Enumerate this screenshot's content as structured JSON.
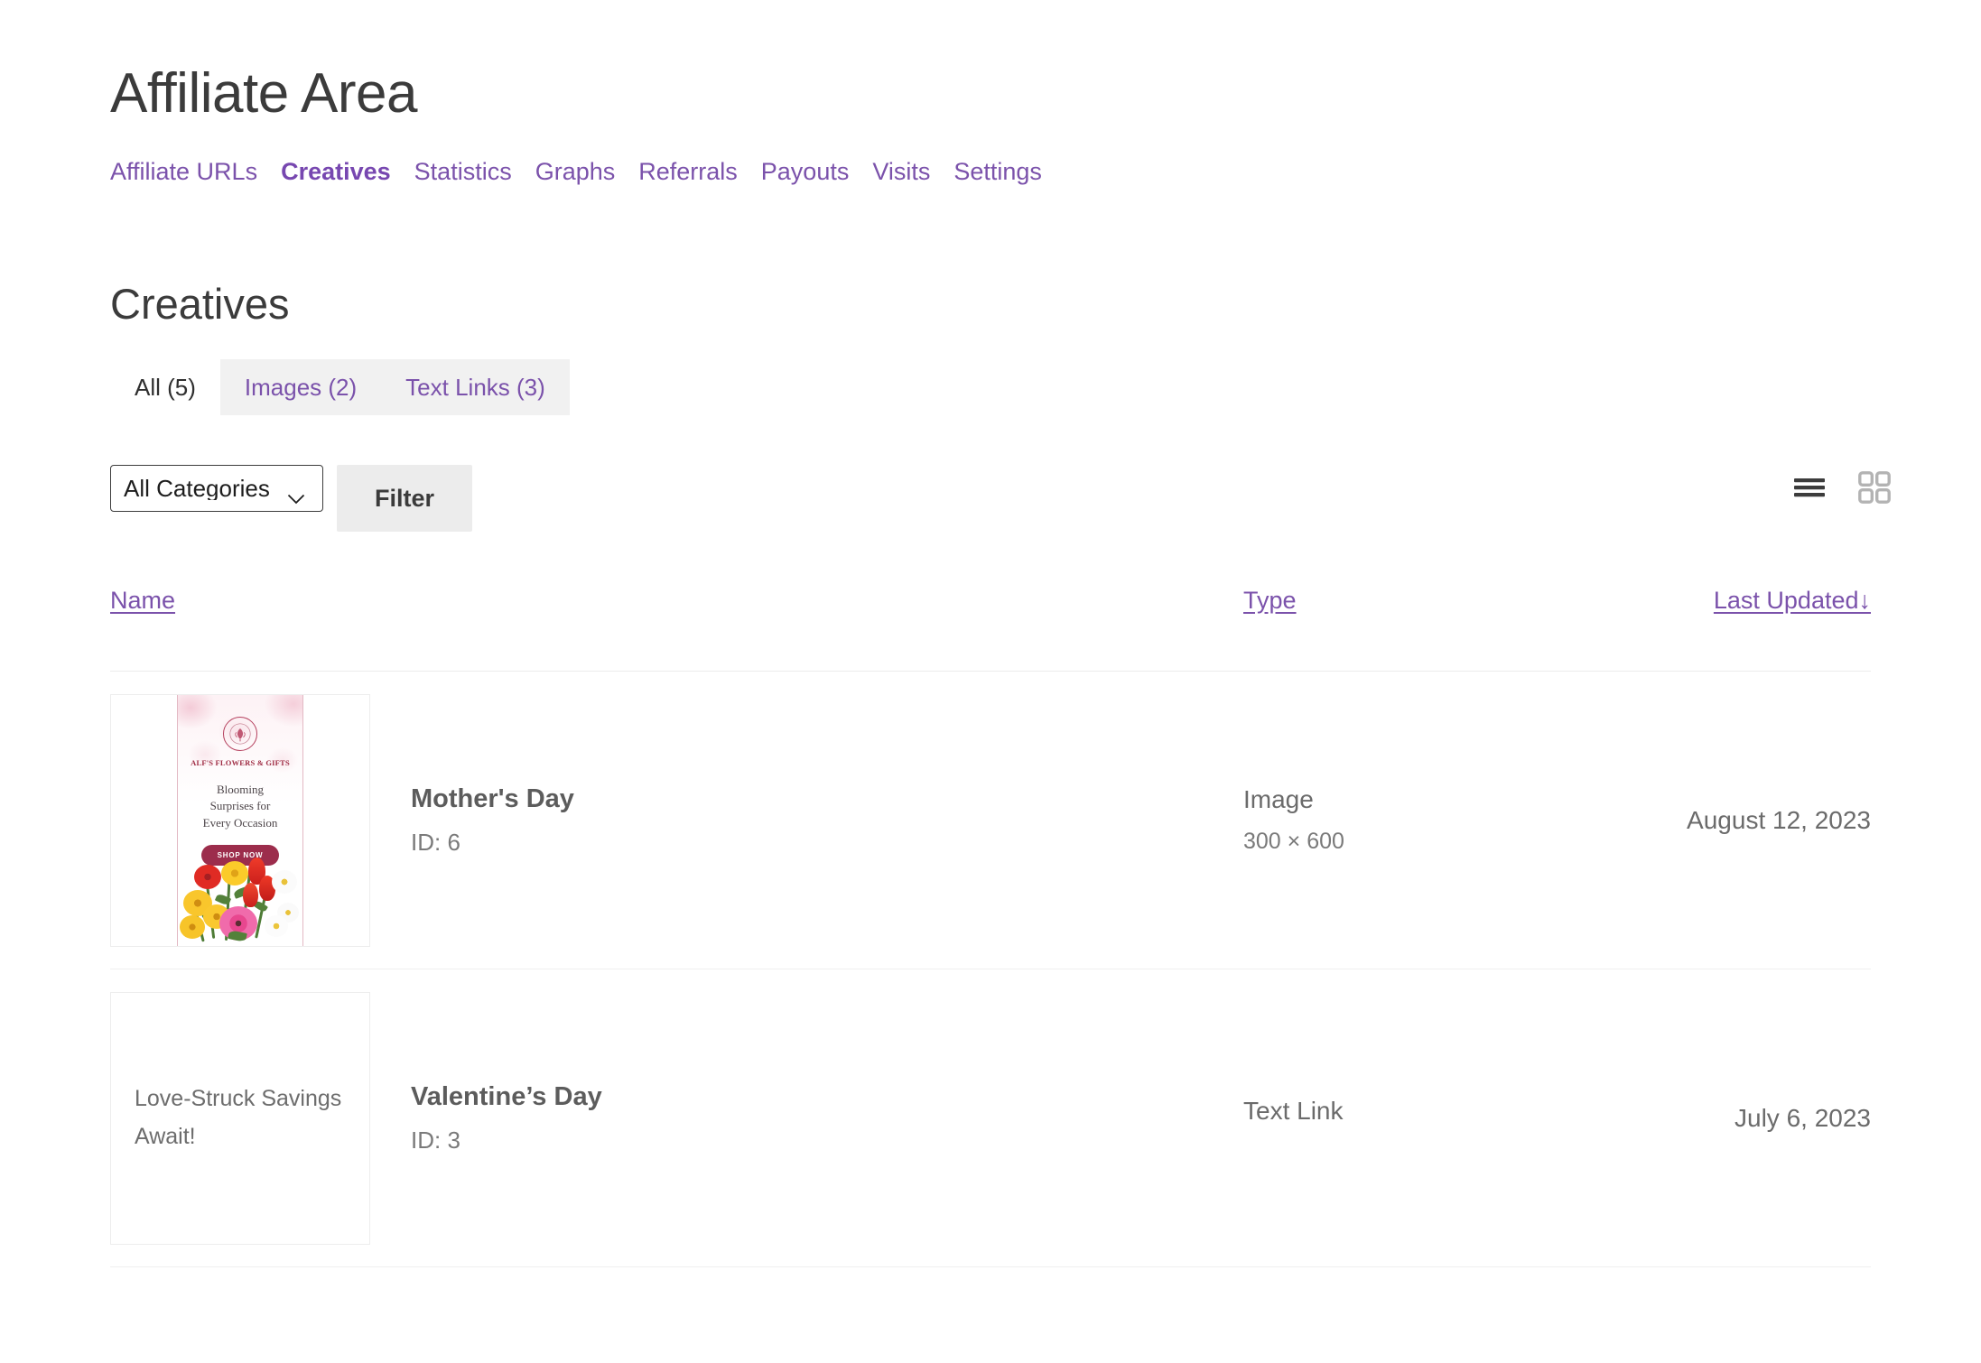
{
  "header": {
    "title": "Affiliate Area",
    "nav": [
      {
        "label": "Affiliate URLs",
        "active": false
      },
      {
        "label": "Creatives",
        "active": true
      },
      {
        "label": "Statistics",
        "active": false
      },
      {
        "label": "Graphs",
        "active": false
      },
      {
        "label": "Referrals",
        "active": false
      },
      {
        "label": "Payouts",
        "active": false
      },
      {
        "label": "Visits",
        "active": false
      },
      {
        "label": "Settings",
        "active": false
      }
    ]
  },
  "section": {
    "title": "Creatives",
    "tabs": [
      {
        "label": "All (5)",
        "active": true
      },
      {
        "label": "Images (2)",
        "active": false
      },
      {
        "label": "Text Links (3)",
        "active": false
      }
    ]
  },
  "filters": {
    "category_selected": "All Categories",
    "category_options": [
      "All Categories"
    ],
    "filter_button": "Filter",
    "view_list_icon": "list-view-icon",
    "view_grid_icon": "grid-view-icon"
  },
  "table": {
    "columns": {
      "name": "Name",
      "type": "Type",
      "last_updated": "Last Updated",
      "sort_arrow": "↓"
    },
    "rows": [
      {
        "name": "Mother's Day",
        "id_label": "ID: 6",
        "type": "Image",
        "dimensions": "300 × 600",
        "last_updated": "August 12, 2023",
        "thumb_kind": "banner",
        "banner": {
          "brand": "ALF'S FLOWERS & GIFTS",
          "headline_line1": "Blooming",
          "headline_line2": "Surprises for",
          "headline_line3": "Every Occasion",
          "cta": "SHOP NOW",
          "brand_color": "#9e2b43",
          "cta_color": "#9c2d4c"
        }
      },
      {
        "name": "Valentine’s Day",
        "id_label": "ID: 3",
        "type": "Text Link",
        "dimensions": "",
        "last_updated": "July 6, 2023",
        "thumb_kind": "text",
        "thumb_text": "Love-Struck Savings Await!"
      }
    ]
  },
  "theme": {
    "link_purple": "#7b52ab",
    "active_purple": "#7747b0",
    "text_gray": "#6b6b6b",
    "tabbar_bg": "#f1f1f1",
    "button_bg": "#ececec"
  }
}
